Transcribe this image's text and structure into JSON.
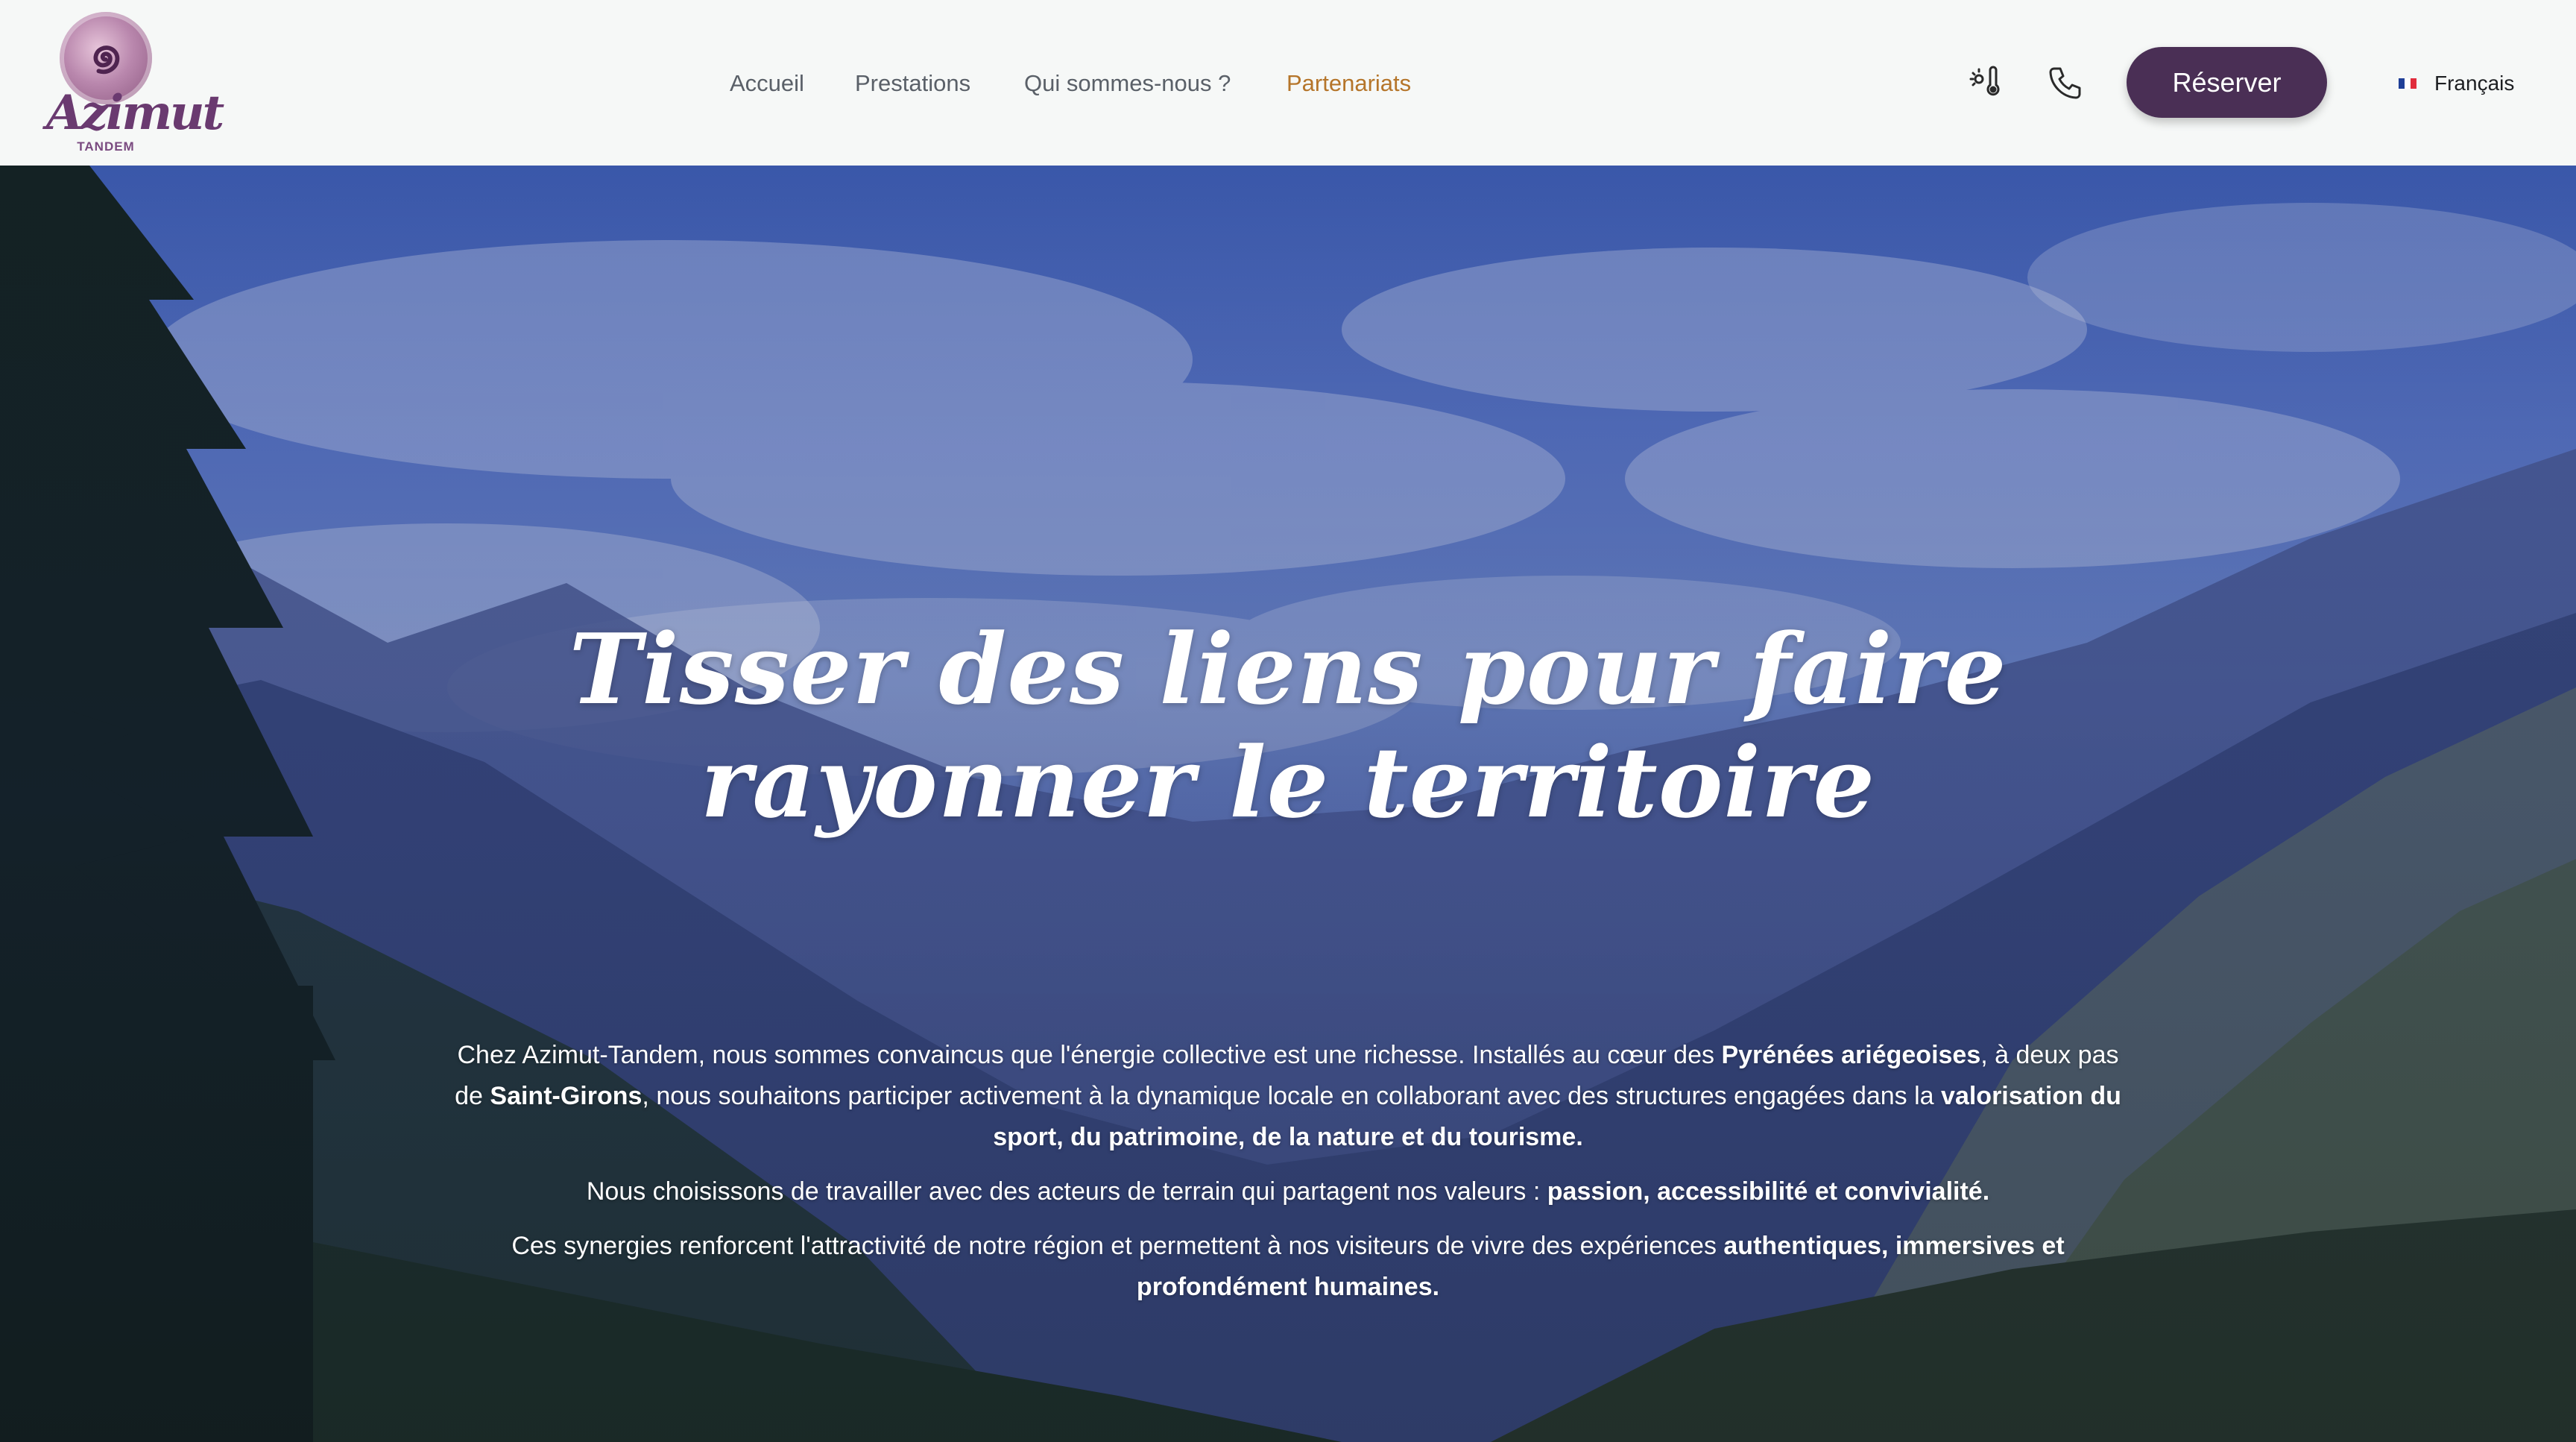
{
  "brand": {
    "name": "Azimut",
    "subtitle": "TANDEM"
  },
  "nav": {
    "items": [
      {
        "label": "Accueil"
      },
      {
        "label": "Prestations"
      },
      {
        "label": "Qui sommes-nous ?"
      },
      {
        "label": "Partenariats"
      }
    ],
    "active": "Partenariats"
  },
  "header": {
    "reserve_label": "Réserver",
    "language": "Français",
    "icons": [
      "weather-icon",
      "phone-icon"
    ]
  },
  "hero": {
    "title": "Tisser des liens pour faire rayonner le territoire",
    "p1": [
      "Chez Azimut-Tandem, nous sommes convaincus que l'énergie collective est une richesse. Installés au cœur des ",
      "Pyrénées ariégeoises",
      ", à deux pas de ",
      "Saint-Girons",
      ", nous souhaitons participer activement à la dynamique locale en collaborant avec des structures engagées dans la ",
      "valorisation du sport, du patrimoine, de la nature et du tourisme."
    ],
    "p2": [
      "Nous choisissons de travailler avec des acteurs de terrain qui partagent nos valeurs : ",
      "passion, accessibilité et convivialité."
    ],
    "p3": [
      "Ces synergies renforcent l'attractivité de notre région et permettent à nos visiteurs de vivre des expériences ",
      "authentiques, immersives et profondément humaines."
    ]
  },
  "colors": {
    "header_bg": "#f6f8f7",
    "nav_text": "#5a6068",
    "nav_active": "#b5752a",
    "button_bg": "#4a2f55",
    "brand_purple": "#6a3a70"
  }
}
